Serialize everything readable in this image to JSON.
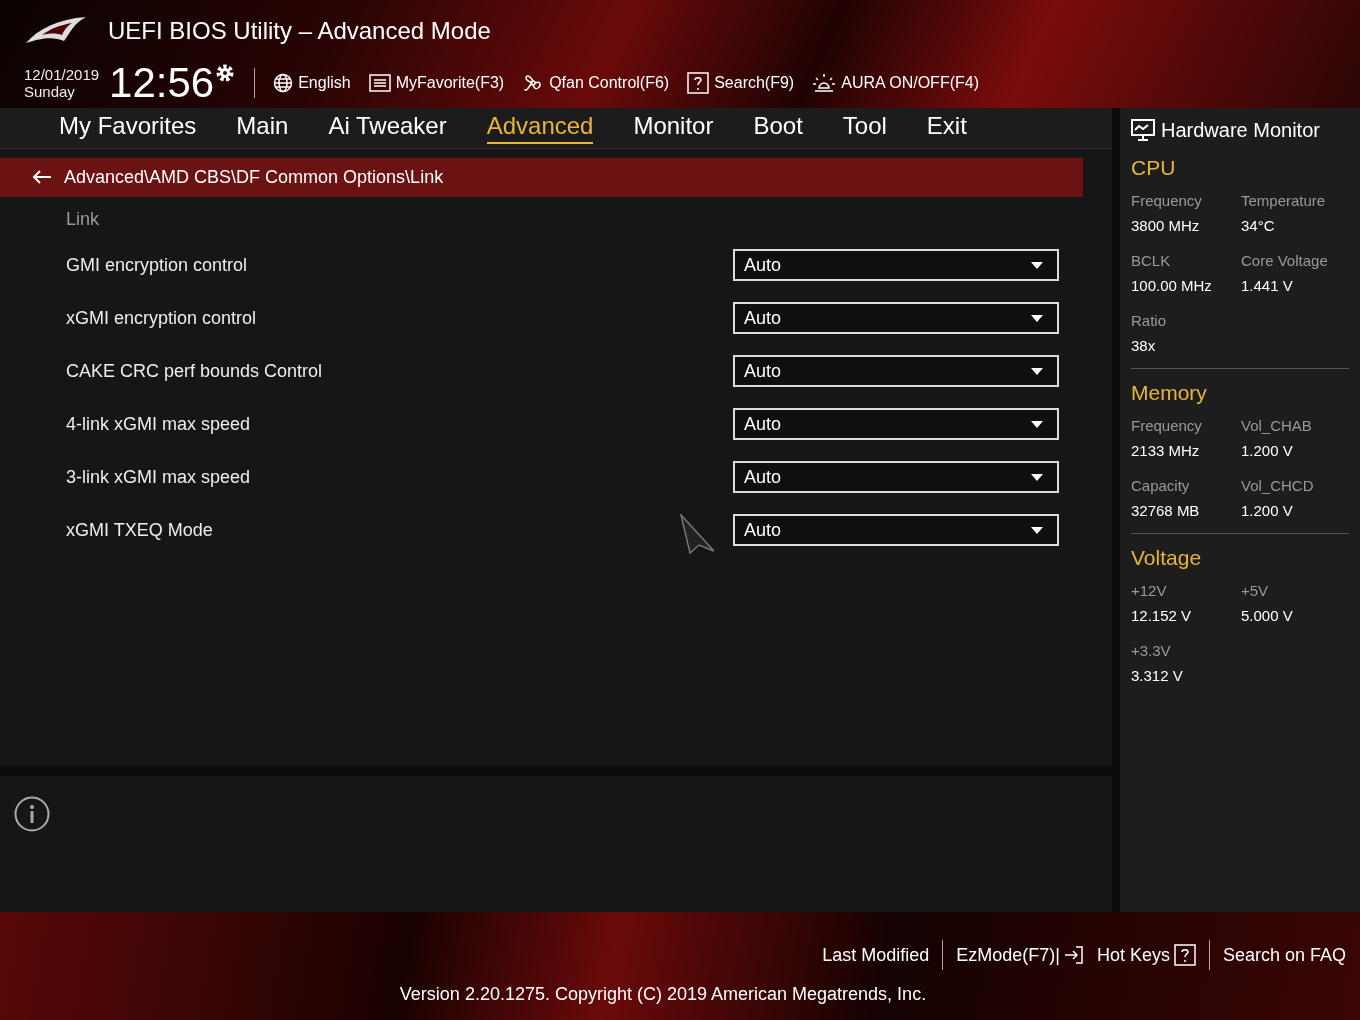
{
  "header": {
    "title": "UEFI BIOS Utility – Advanced Mode",
    "date": "12/01/2019",
    "day": "Sunday",
    "time": "12:56",
    "tools": [
      {
        "kind": "globe",
        "label": "English"
      },
      {
        "kind": "favorite",
        "label": "MyFavorite(F3)"
      },
      {
        "kind": "fan",
        "label": "Qfan Control(F6)"
      },
      {
        "kind": "help",
        "label": "Search(F9)"
      },
      {
        "kind": "aura",
        "label": "AURA ON/OFF(F4)"
      }
    ]
  },
  "tabs": [
    {
      "label": "My Favorites",
      "selected": false
    },
    {
      "label": "Main",
      "selected": false
    },
    {
      "label": "Ai Tweaker",
      "selected": false
    },
    {
      "label": "Advanced",
      "selected": true
    },
    {
      "label": "Monitor",
      "selected": false
    },
    {
      "label": "Boot",
      "selected": false
    },
    {
      "label": "Tool",
      "selected": false
    },
    {
      "label": "Exit",
      "selected": false
    }
  ],
  "breadcrumb": "Advanced\\AMD CBS\\DF Common Options\\Link",
  "section_heading": "Link",
  "settings": [
    {
      "label": "GMI encryption control",
      "value": "Auto"
    },
    {
      "label": "xGMI encryption control",
      "value": "Auto"
    },
    {
      "label": "CAKE CRC perf bounds Control",
      "value": "Auto"
    },
    {
      "label": "4-link xGMI max speed",
      "value": "Auto"
    },
    {
      "label": "3-link xGMI max speed",
      "value": "Auto"
    },
    {
      "label": "xGMI TXEQ Mode",
      "value": "Auto"
    }
  ],
  "hardware_monitor": {
    "title": "Hardware Monitor",
    "sections": [
      {
        "title": "CPU",
        "items": [
          {
            "label": "Frequency",
            "value": "3800 MHz"
          },
          {
            "label": "Temperature",
            "value": "34°C"
          },
          {
            "label": "BCLK",
            "value": "100.00 MHz"
          },
          {
            "label": "Core Voltage",
            "value": "1.441 V"
          },
          {
            "label": "Ratio",
            "value": "38x"
          }
        ]
      },
      {
        "title": "Memory",
        "items": [
          {
            "label": "Frequency",
            "value": "2133 MHz"
          },
          {
            "label": "Vol_CHAB",
            "value": "1.200 V"
          },
          {
            "label": "Capacity",
            "value": "32768 MB"
          },
          {
            "label": "Vol_CHCD",
            "value": "1.200 V"
          }
        ]
      },
      {
        "title": "Voltage",
        "items": [
          {
            "label": "+12V",
            "value": "12.152 V"
          },
          {
            "label": "+5V",
            "value": "5.000 V"
          },
          {
            "label": "+3.3V",
            "value": "3.312 V"
          }
        ]
      }
    ]
  },
  "footer": {
    "links": [
      {
        "kind": "plain",
        "label": "Last Modified"
      },
      {
        "kind": "exit",
        "label": "EzMode(F7)|"
      },
      {
        "kind": "help",
        "label": "Hot Keys"
      },
      {
        "kind": "plain",
        "label": "Search on FAQ"
      }
    ],
    "version": "Version 2.20.1275. Copyright (C) 2019 American Megatrends, Inc."
  }
}
